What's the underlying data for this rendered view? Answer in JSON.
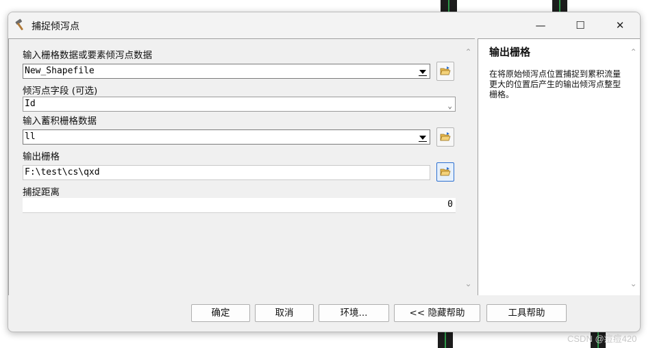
{
  "window": {
    "title": "捕捉倾泻点",
    "icon": "hammer-icon",
    "minimize": "—",
    "maximize": "☐",
    "close": "✕"
  },
  "form": {
    "input_raster_label": "输入栅格数据或要素倾泻点数据",
    "input_raster_value": "New_Shapefile",
    "pour_field_label": "倾泻点字段 (可选)",
    "pour_field_value": "Id",
    "accum_label": "输入蓄积栅格数据",
    "accum_value": "ll",
    "output_label": "输出栅格",
    "output_value": "F:\\test\\cs\\qxd",
    "snap_label": "捕捉距离",
    "snap_value": "0"
  },
  "help": {
    "title": "输出栅格",
    "body": "在将原始倾泻点位置捕捉到累积流量更大的位置后产生的输出倾泻点整型栅格。"
  },
  "buttons": {
    "ok": "确定",
    "cancel": "取消",
    "env": "环境...",
    "hide_help": "<< 隐藏帮助",
    "tool_help": "工具帮助"
  },
  "watermark": "CSDN @痘痘420",
  "colors": {
    "dialog_bg": "#f0f0f0",
    "focus_blue": "#2b6fd1",
    "bg_strip_green": "#2e9a4a"
  }
}
